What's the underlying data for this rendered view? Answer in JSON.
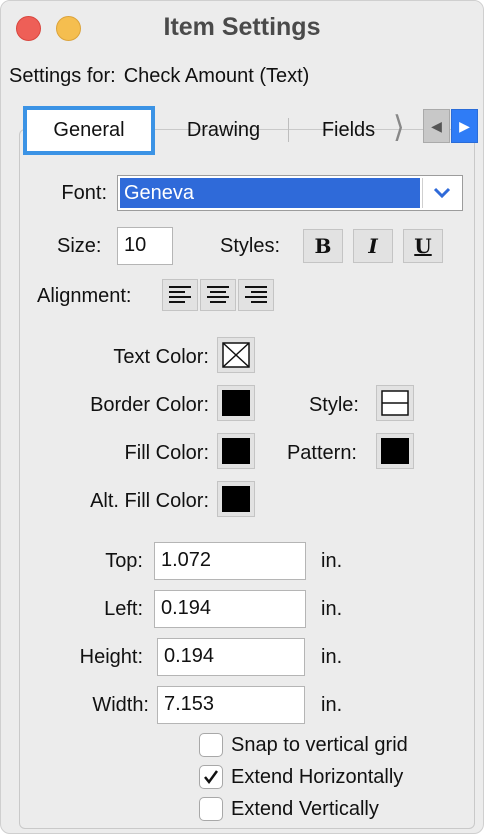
{
  "window": {
    "title": "Item Settings"
  },
  "settings_for": {
    "label": "Settings for:",
    "value": "Check Amount (Text)"
  },
  "tabs": [
    {
      "label": "General",
      "selected": true
    },
    {
      "label": "Drawing"
    },
    {
      "label": "Fields"
    }
  ],
  "font": {
    "label": "Font:",
    "value": "Geneva"
  },
  "size": {
    "label": "Size:",
    "value": "10"
  },
  "styles": {
    "label": "Styles:",
    "buttons": [
      "B",
      "I",
      "U"
    ]
  },
  "alignment": {
    "label": "Alignment:"
  },
  "colors": {
    "text_color": "Text Color:",
    "border_color": "Border Color:",
    "style": "Style:",
    "fill_color": "Fill Color:",
    "pattern": "Pattern:",
    "alt_fill_color": "Alt. Fill Color:"
  },
  "position": {
    "top": {
      "label": "Top:",
      "value": "1.072",
      "unit": "in."
    },
    "left": {
      "label": "Left:",
      "value": "0.194",
      "unit": "in."
    },
    "height": {
      "label": "Height:",
      "value": "0.194",
      "unit": "in."
    },
    "width": {
      "label": "Width:",
      "value": "7.153",
      "unit": "in."
    }
  },
  "checkboxes": [
    {
      "label": "Snap to vertical grid",
      "checked": false
    },
    {
      "label": "Extend Horizontally",
      "checked": true
    },
    {
      "label": "Extend Vertically",
      "checked": false
    }
  ],
  "accent_colors": {
    "tab_focus": "#3b93e5",
    "selection": "#2f6ad9",
    "close": "#ee5f57",
    "minimize": "#f5be4f"
  }
}
